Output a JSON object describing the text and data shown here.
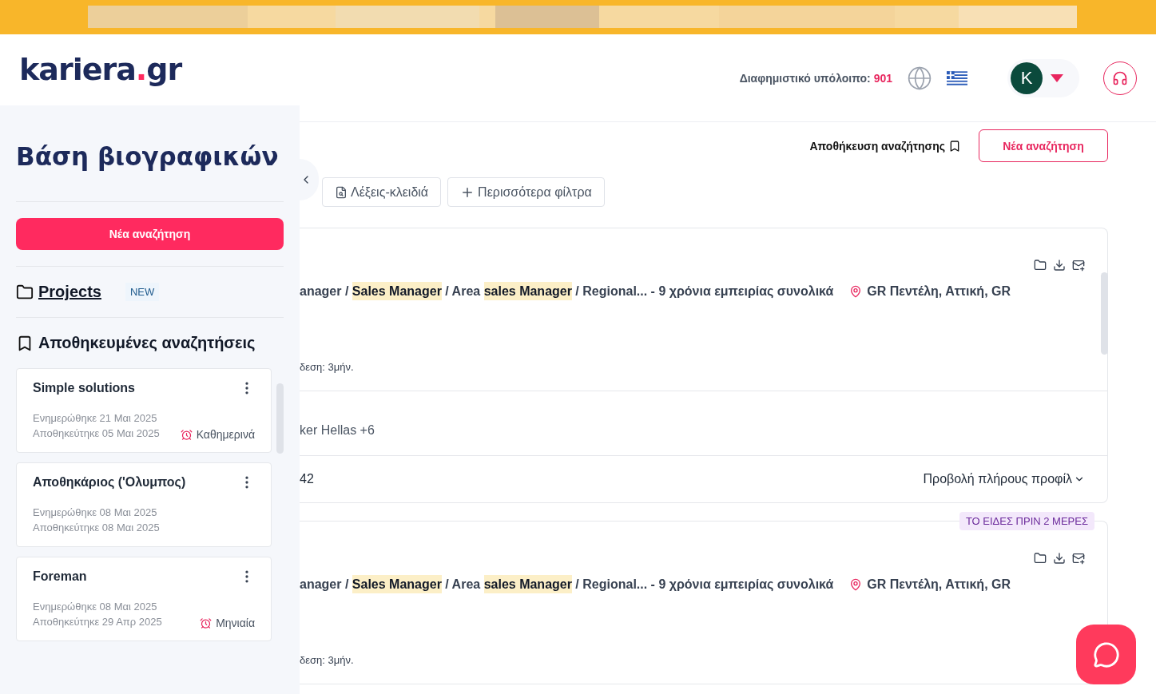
{
  "header": {
    "logo": {
      "name": "kariera",
      "dot": ".",
      "tld": "gr"
    },
    "balance_label": "Διαφημιστικό υπόλοιπο:",
    "balance_value": "901",
    "avatar": "K"
  },
  "sidebar": {
    "title": "Βάση βιογραφικών",
    "new_search": "Νέα αναζήτηση",
    "projects": {
      "label": "Projects",
      "badge": "NEW"
    },
    "saved_title": "Αποθηκευμένες αναζητήσεις",
    "saved": [
      {
        "name": "Simple solutions",
        "updated": "Ενημερώθηκε 21 Μαι 2025",
        "saved": "Αποθηκεύτηκε 05 Μαι 2025",
        "frequency": "Καθημερινά"
      },
      {
        "name": "Αποθηκάριος ('Ολυμπος)",
        "updated": "Ενημερώθηκε 08 Μαι 2025",
        "saved": "Αποθηκεύτηκε 08 Μαι 2025"
      },
      {
        "name": "Foreman",
        "updated": "Ενημερώθηκε 08 Μαι 2025",
        "saved": "Αποθηκεύτηκε 29 Απρ 2025",
        "frequency": "Μηνιαία"
      }
    ]
  },
  "toolbar": {
    "save_search": "Αποθήκευση αναζήτησης",
    "new_search": "Νέα αναζήτηση"
  },
  "filters": [
    {
      "kind": "keywords",
      "label": "Λέξεις-κλειδιά"
    },
    {
      "kind": "more",
      "label": "Περισσότερα φίλτρα"
    }
  ],
  "results": [
    {
      "headline": [
        {
          "text": "anager / ",
          "highlight": false
        },
        {
          "text": "Sales Manager",
          "highlight": true
        },
        {
          "text": " / Area ",
          "highlight": false
        },
        {
          "text": "sales Manager",
          "highlight": true
        },
        {
          "text": " / Regional... - 9 χρόνια εμπειρίας συνολικά",
          "highlight": false
        }
      ],
      "location": "GR Πεντέλη, Αττική, GR",
      "availability": "δεση: 3μήν.",
      "companies": "ker Hellas +6",
      "footer": "42",
      "profile_link": "Προβολή πλήρους προφίλ"
    },
    {
      "badge": "ΤΟ ΕΙΔΕΣ ΠΡΙΝ 2 ΜΕΡΕΣ",
      "headline": [
        {
          "text": "anager / ",
          "highlight": false
        },
        {
          "text": "Sales Manager",
          "highlight": true
        },
        {
          "text": " / Area ",
          "highlight": false
        },
        {
          "text": "sales Manager",
          "highlight": true
        },
        {
          "text": " / Regional... - 9 χρόνια εμπειρίας συνολικά",
          "highlight": false
        }
      ],
      "location": "GR Πεντέλη, Αττική, GR",
      "availability": "δεση: 3μήν."
    }
  ]
}
